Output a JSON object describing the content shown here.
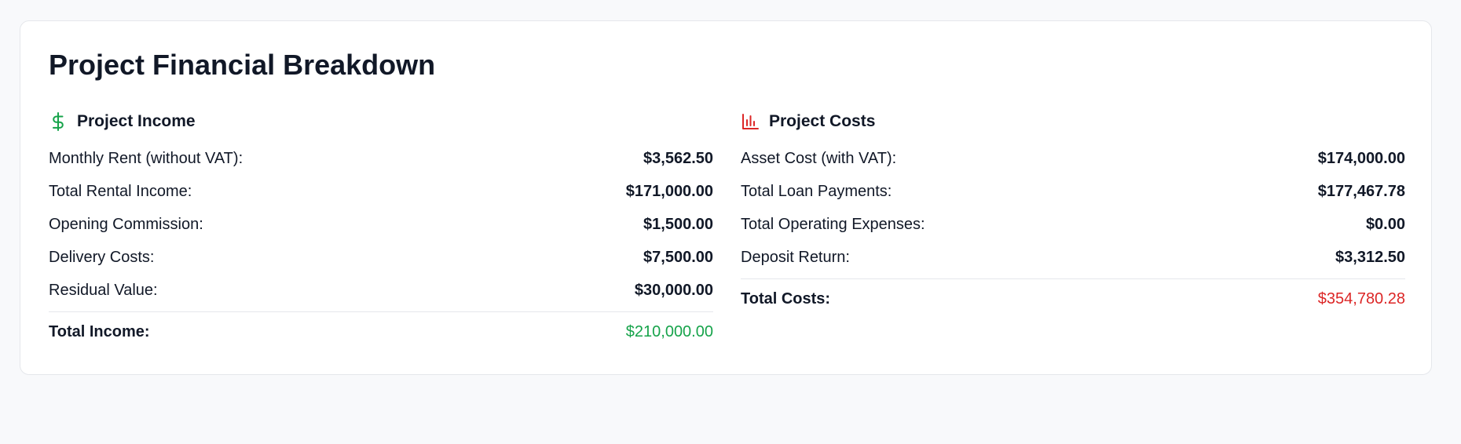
{
  "title": "Project Financial Breakdown",
  "colors": {
    "income_accent": "#16a34a",
    "cost_accent": "#dc2626"
  },
  "income": {
    "icon": "dollar-icon",
    "title": "Project Income",
    "rows": [
      {
        "label": "Monthly Rent (without VAT):",
        "value": "$3,562.50"
      },
      {
        "label": "Total Rental Income:",
        "value": "$171,000.00"
      },
      {
        "label": "Opening Commission:",
        "value": "$1,500.00"
      },
      {
        "label": "Delivery Costs:",
        "value": "$7,500.00"
      },
      {
        "label": "Residual Value:",
        "value": "$30,000.00"
      }
    ],
    "total": {
      "label": "Total Income:",
      "value": "$210,000.00"
    }
  },
  "costs": {
    "icon": "bar-chart-icon",
    "title": "Project Costs",
    "rows": [
      {
        "label": "Asset Cost (with VAT):",
        "value": "$174,000.00"
      },
      {
        "label": "Total Loan Payments:",
        "value": "$177,467.78"
      },
      {
        "label": "Total Operating Expenses:",
        "value": "$0.00"
      },
      {
        "label": "Deposit Return:",
        "value": "$3,312.50"
      }
    ],
    "total": {
      "label": "Total Costs:",
      "value": "$354,780.28"
    }
  }
}
